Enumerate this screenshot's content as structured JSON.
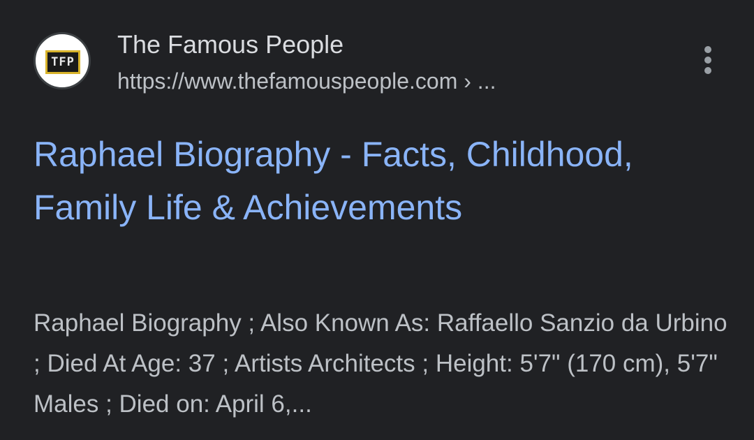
{
  "result": {
    "source": {
      "favicon_text": "TFP",
      "site_name": "The Famous People",
      "url": "https://www.thefamouspeople.com › ..."
    },
    "more_icon": "more-vert-icon",
    "title": "Raphael Biography - Facts, Childhood, Family Life & Achievements",
    "snippet": "Raphael Biography ; Also Known As: Raffaello Sanzio da Urbino ; Died At Age: 37 ; Artists Architects ; Height: 5'7\" (170 cm), 5'7\" Males ; Died on: April 6,..."
  },
  "colors": {
    "background": "#202124",
    "title_link": "#8ab4f8",
    "text": "#bdc1c6",
    "favicon_accent": "#d8b32a"
  }
}
